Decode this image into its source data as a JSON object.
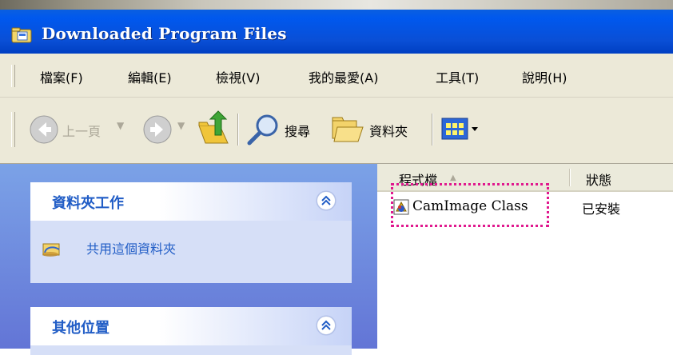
{
  "window": {
    "title": "Downloaded Program Files"
  },
  "menu": {
    "items": [
      {
        "label": "檔案(F)"
      },
      {
        "label": "編輯(E)"
      },
      {
        "label": "檢視(V)"
      },
      {
        "label": "我的最愛(A)"
      },
      {
        "label": "工具(T)"
      },
      {
        "label": "說明(H)"
      }
    ]
  },
  "toolbar": {
    "back_label": "上一頁",
    "search_label": "搜尋",
    "folders_label": "資料夾"
  },
  "left_pane": {
    "folder_tasks": {
      "title": "資料夾工作",
      "share_link": "共用這個資料夾"
    },
    "other_places": {
      "title": "其他位置"
    }
  },
  "list": {
    "columns": [
      "程式檔",
      "狀態"
    ],
    "rows": [
      {
        "name": "CamImage Class",
        "status": "已安裝"
      }
    ]
  },
  "colors": {
    "titlebar": "#0058ee",
    "taskpane_bg": "#6375d6",
    "taskpane_title": "#215dc6",
    "highlight": "#e0198e"
  }
}
